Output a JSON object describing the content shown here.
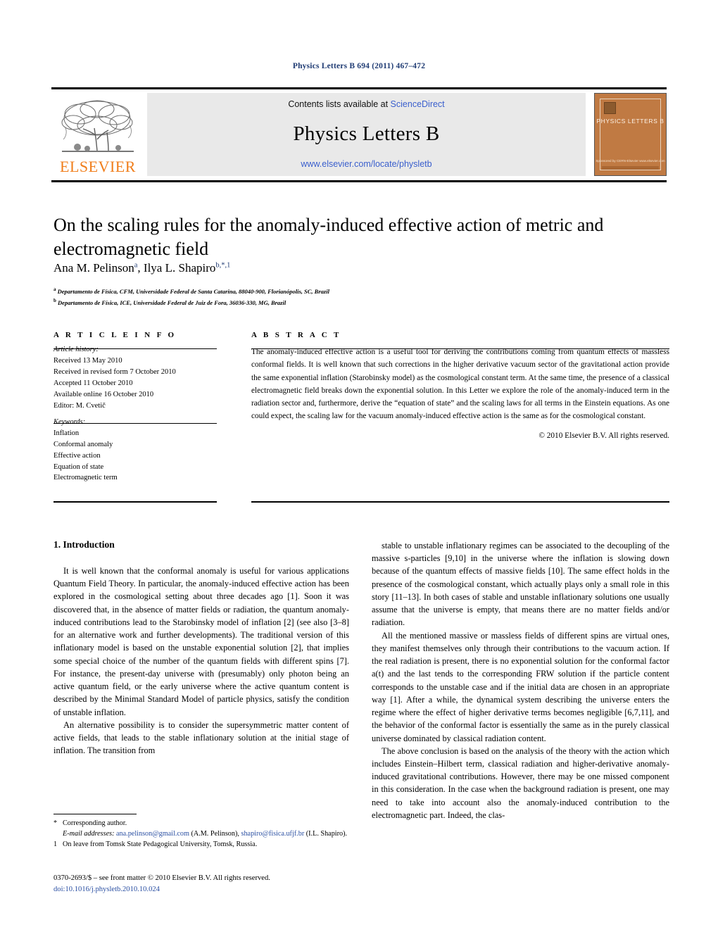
{
  "running_head": "Physics Letters B 694 (2011) 467–472",
  "masthead": {
    "elsevier_wordmark": "ELSEVIER",
    "contents_prefix": "Contents lists available at ",
    "sciencedirect": "ScienceDirect",
    "journal_title": "Physics Letters B",
    "journal_url": "www.elsevier.com/locate/physletb",
    "cover_title": "PHYSICS LETTERS B",
    "cover_footer": "Sponsored by\nCERN-Elsevier\nwww.elsevier.com"
  },
  "article": {
    "title": "On the scaling rules for the anomaly-induced effective action of metric and electromagnetic field",
    "authors_html": "Ana M. Pelinson a, Ilya L. Shapiro b,*,1",
    "author_1": "Ana M. Pelinson",
    "author_1_sup": "a",
    "author_2": "Ilya L. Shapiro",
    "author_2_sup": "b,*,1",
    "affiliation_a_sup": "a",
    "affiliation_a": "Departamento de Física, CFM, Universidade Federal de Santa Catarina, 88040-900, Florianópolis, SC, Brazil",
    "affiliation_b_sup": "b",
    "affiliation_b": "Departamento de Física, ICE, Universidade Federal de Juiz de Fora, 36036-330, MG, Brazil"
  },
  "info": {
    "heading": "A R T I C L E    I N F O",
    "history_label": "Article history:",
    "history": [
      "Received 13 May 2010",
      "Received in revised form 7 October 2010",
      "Accepted 11 October 2010",
      "Available online 16 October 2010",
      "Editor: M. Cvetič"
    ],
    "keywords_label": "Keywords:",
    "keywords": [
      "Inflation",
      "Conformal anomaly",
      "Effective action",
      "Equation of state",
      "Electromagnetic term"
    ]
  },
  "abstract": {
    "heading": "A B S T R A C T",
    "text": "The anomaly-induced effective action is a useful tool for deriving the contributions coming from quantum effects of massless conformal fields. It is well known that such corrections in the higher derivative vacuum sector of the gravitational action provide the same exponential inflation (Starobinsky model) as the cosmological constant term. At the same time, the presence of a classical electromagnetic field breaks down the exponential solution. In this Letter we explore the role of the anomaly-induced term in the radiation sector and, furthermore, derive the “equation of state” and the scaling laws for all terms in the Einstein equations. As one could expect, the scaling law for the vacuum anomaly-induced effective action is the same as for the cosmological constant.",
    "copyright": "© 2010 Elsevier B.V. All rights reserved."
  },
  "body": {
    "section_heading": "1. Introduction",
    "left_paragraphs": [
      "It is well known that the conformal anomaly is useful for various applications Quantum Field Theory. In particular, the anomaly-induced effective action has been explored in the cosmological setting about three decades ago [1]. Soon it was discovered that, in the absence of matter fields or radiation, the quantum anomaly-induced contributions lead to the Starobinsky model of inflation [2] (see also [3–8] for an alternative work and further developments). The traditional version of this inflationary model is based on the unstable exponential solution [2], that implies some special choice of the number of the quantum fields with different spins [7]. For instance, the present-day universe with (presumably) only photon being an active quantum field, or the early universe where the active quantum content is described by the Minimal Standard Model of particle physics, satisfy the condition of unstable inflation.",
      "An alternative possibility is to consider the supersymmetric matter content of active fields, that leads to the stable inflationary solution at the initial stage of inflation. The transition from"
    ],
    "right_paragraphs": [
      "stable to unstable inflationary regimes can be associated to the decoupling of the massive s-particles [9,10] in the universe where the inflation is slowing down because of the quantum effects of massive fields [10]. The same effect holds in the presence of the cosmological constant, which actually plays only a small role in this story [11–13]. In both cases of stable and unstable inflationary solutions one usually assume that the universe is empty, that means there are no matter fields and/or radiation.",
      "All the mentioned massive or massless fields of different spins are virtual ones, they manifest themselves only through their contributions to the vacuum action. If the real radiation is present, there is no exponential solution for the conformal factor a(t) and the last tends to the corresponding FRW solution if the particle content corresponds to the unstable case and if the initial data are chosen in an appropriate way [1]. After a while, the dynamical system describing the universe enters the regime where the effect of higher derivative terms becomes negligible [6,7,11], and the behavior of the conformal factor is essentially the same as in the purely classical universe dominated by classical radiation content.",
      "The above conclusion is based on the analysis of the theory with the action which includes Einstein–Hilbert term, classical radiation and higher-derivative anomaly-induced gravitational contributions. However, there may be one missed component in this consideration. In the case when the background radiation is present, one may need to take into account also the anomaly-induced contribution to the electromagnetic part. Indeed, the clas-"
    ]
  },
  "footnotes": {
    "corresponding_mark": "*",
    "corresponding_text": "Corresponding author.",
    "email_label": "E-mail addresses:",
    "email_1": "ana.pelinson@gmail.com",
    "email_1_owner": "(A.M. Pelinson),",
    "email_2": "shapiro@fisica.ufjf.br",
    "email_2_owner": "(I.L. Shapiro).",
    "note_mark": "1",
    "note_text": "On leave from Tomsk State Pedagogical University, Tomsk, Russia."
  },
  "imprint": {
    "issn_line": "0370-2693/$ – see front matter  © 2010 Elsevier B.V. All rights reserved.",
    "doi": "doi:10.1016/j.physletb.2010.10.024"
  },
  "colors": {
    "link_blue": "#2a4fa2",
    "running_head_blue": "#1f3b73",
    "elsevier_orange": "#f07d1a",
    "banner_grey": "#e9e9e9",
    "cover_orange": "#c07a43"
  }
}
